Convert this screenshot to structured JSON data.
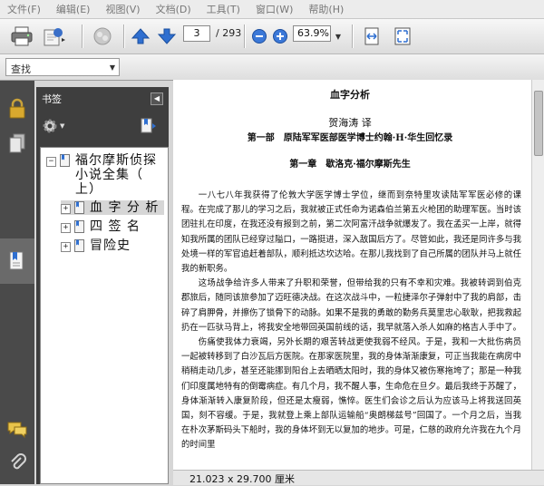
{
  "menu": [
    "文件(F)",
    "编辑(E)",
    "视图(V)",
    "文档(D)",
    "工具(T)",
    "窗口(W)",
    "帮助(H)"
  ],
  "toolbar": {
    "page_current": "3",
    "page_total": "/ 293",
    "zoom": "63.9%",
    "icons": [
      "printer-icon",
      "email-icon",
      "share-icon",
      "prev-page-icon",
      "next-page-icon",
      "zoom-out-icon",
      "zoom-in-icon",
      "fit-width-icon",
      "full-screen-icon"
    ]
  },
  "find": {
    "label": "查找"
  },
  "rail": {
    "icons": [
      "lock-icon",
      "pages-icon",
      "bookmark-icon",
      "comment-icon",
      "attachment-icon"
    ]
  },
  "bookmarks": {
    "title": "书签",
    "items": [
      {
        "label": "福尔摩斯侦探小说全集（上）",
        "lines": [
          "福尔摩斯侦探",
          "小说全集（",
          "上）"
        ],
        "expander": "−"
      },
      {
        "label": "血字分析",
        "display": "血 字 分 析",
        "expander": "+",
        "selected": true
      },
      {
        "label": "四签名",
        "display": "四 签 名",
        "expander": "+"
      },
      {
        "label": "冒险史",
        "display": "冒险史",
        "expander": "+"
      }
    ]
  },
  "document": {
    "title": "血字分析",
    "translator": "贺海涛 译",
    "part": "第一部　原陆军军医部医学博士约翰·H·华生回忆录",
    "chapter": "第一章　歇洛克·福尔摩斯先生",
    "paragraphs": [
      "一八七八年我获得了伦敦大学医学博士学位，继而到奈特里攻读陆军军医必修的课程。在完成了那儿的学习之后，我就被正式任命为诺森伯兰第五火枪团的助理军医。当时该团驻扎在印度，在我还没有报到之前，第二次阿富汗战争就爆发了。我在孟买一上岸，就得知我所属的团队已经穿过隘口，一路挺进，深入敌国后方了。尽管如此，我还是同许多与我处境一样的军官追赶着部队，顺利抵达坎达哈。在那儿我找到了自己所属的团队并马上就任我的新职务。",
      "这场战争给许多人带来了升职和荣誉，但带给我的只有不幸和灾难。我被转调到伯克郡旅后，随同该旅参加了迈旺德决战。在这次战斗中，一粒捷泽尔子弹射中了我的肩部，击碎了肩胛骨，并擦伤了锁骨下的动脉。如果不是我的勇敢的勤务兵莫里忠心耿耿，把我救起扔在一匹驮马背上，将我安全地带回英国前线的话，我早就落入杀人如麻的格吉人手中了。",
      "伤痛使我体力衰竭，另外长期的艰苦转战更使我弱不经风。于是，我和一大批伤病员一起被转移到了白沙瓦后方医院。在那家医院里，我的身体渐渐康复，可正当我能在病房中稍稍走动几步，甚至还能挪到阳台上去晒晒太阳时，我的身体又被伤寒拖垮了；那是一种我们印度属地特有的倒霉病症。有几个月，我不醒人事，生命危在旦夕。最后我终于苏醒了，身体渐渐转入康复阶段，但还是太瘦弱，憔悴。医生们会诊之后认为应该马上将我送回英国，刻不容缓。于是，我就登上乘上部队运输船“奥朗梯兹号”回国了。一个月之后，当我在朴次茅斯码头下船时，我的身体坏到无以复加的地步。可是，仁慈的政府允许我在九个月的时间里"
    ]
  },
  "status": {
    "page_size": "21.023 x 29.700 厘米"
  }
}
